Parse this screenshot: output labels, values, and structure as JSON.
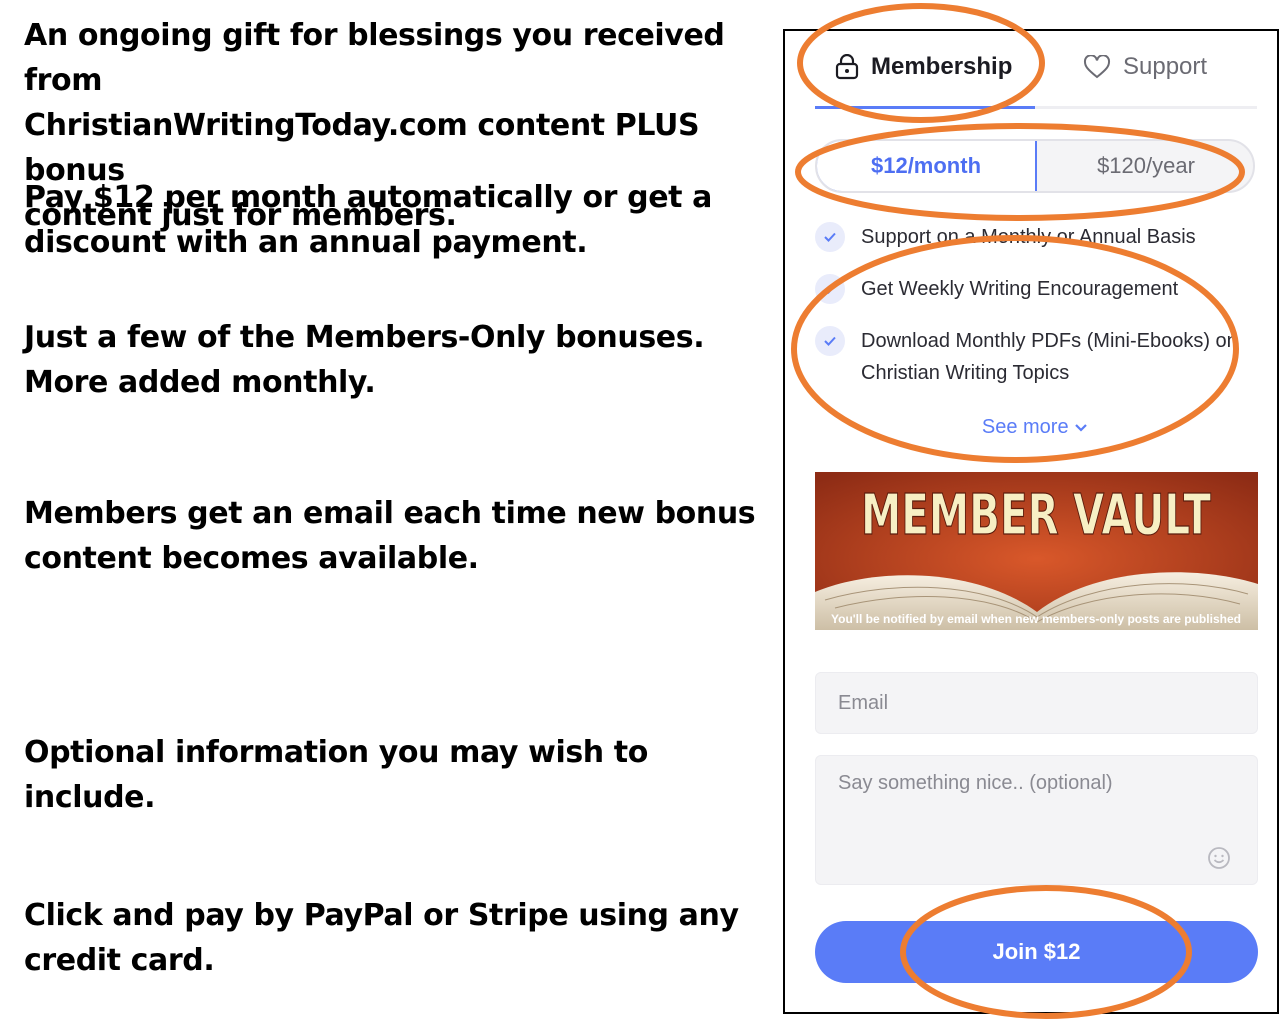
{
  "notes": {
    "intro": "An ongoing gift for blessings you received from\nChristianWritingToday.com content PLUS bonus\ncontent just for members.",
    "pricing": "Pay $12 per month automatically or get a\ndiscount with an annual payment.",
    "bonuses": "Just a few of the Members-Only bonuses.\nMore added monthly.",
    "email_notice": "Members get an email each time new bonus\ncontent becomes available.",
    "optional_info": "Optional information you may wish to include.",
    "payment": "Click and pay by PayPal or Stripe using any\ncredit card."
  },
  "widget": {
    "tabs": [
      {
        "label": "Membership",
        "icon": "lock-icon",
        "active": true
      },
      {
        "label": "Support",
        "icon": "heart-icon",
        "active": false
      }
    ],
    "billing": {
      "monthly": "$12/month",
      "yearly": "$120/year",
      "selected": "monthly"
    },
    "benefits": [
      "Support on a Monthly or Annual Basis",
      "Get Weekly Writing Encouragement",
      "Download Monthly PDFs (Mini-Ebooks) on Christian Writing Topics"
    ],
    "see_more": "See more",
    "banner": {
      "title": "MEMBER VAULT",
      "caption": "You'll be notified by email when new members-only posts are published"
    },
    "email_placeholder": "Email",
    "message_placeholder": "Say something nice.. (optional)",
    "join_label": "Join $12"
  },
  "colors": {
    "accent": "#5a7cf7",
    "annotation": "#ed7d31",
    "banner_bg": "#c4461f"
  }
}
